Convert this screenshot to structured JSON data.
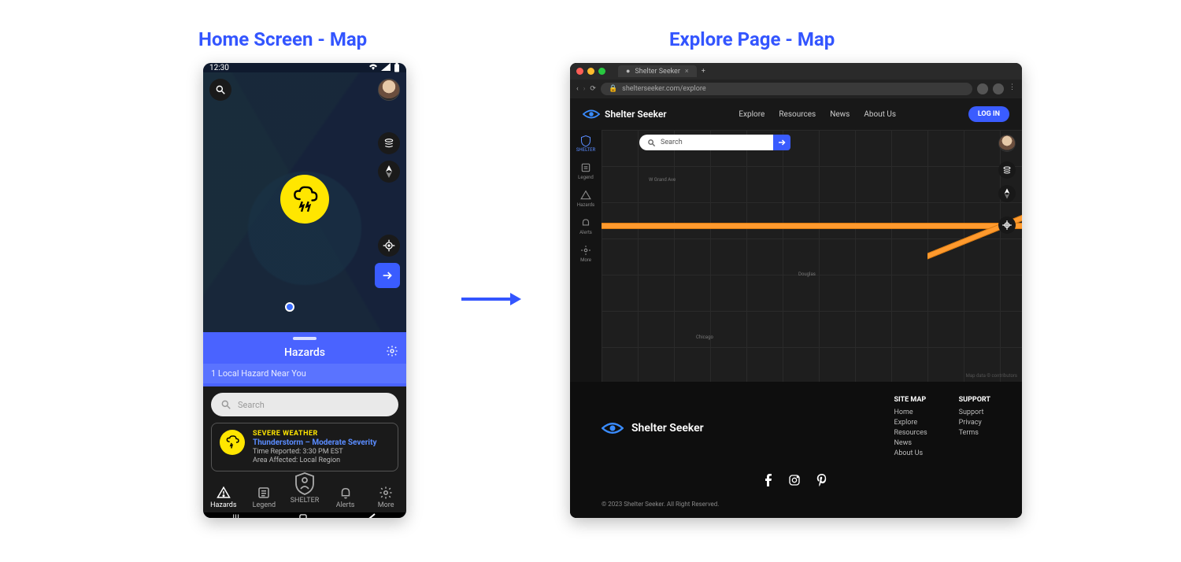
{
  "headings": {
    "left": "Home Screen - Map",
    "right": "Explore Page - Map"
  },
  "mobile": {
    "status_time": "12:30",
    "hazards_panel": {
      "title": "Hazards",
      "subhead": "1 Local Hazard Near You",
      "search_placeholder": "Search"
    },
    "severe_card": {
      "tag": "SEVERE WEATHER",
      "title": "Thunderstorm – Moderate Severity",
      "time": "Time Reported: 3:30 PM EST",
      "area": "Area Affected: Local Region"
    },
    "tabs": {
      "hazards": "Hazards",
      "legend": "Legend",
      "shelter": "SHELTER",
      "alerts": "Alerts",
      "more": "More"
    }
  },
  "desktop": {
    "browser": {
      "tab_title": "Shelter Seeker",
      "url": "shelterseeker.com/explore"
    },
    "brand": "Shelter Seeker",
    "nav": {
      "explore": "Explore",
      "resources": "Resources",
      "news": "News",
      "about": "About Us"
    },
    "login": "LOG IN",
    "sidebar": {
      "shelter": "SHELTER",
      "legend": "Legend",
      "hazards": "Hazards",
      "alerts": "Alerts",
      "more": "More"
    },
    "search_placeholder": "Search",
    "footer": {
      "sitemap_h": "SITE MAP",
      "sitemap": {
        "home": "Home",
        "explore": "Explore",
        "resources": "Resources",
        "news": "News",
        "about": "About Us"
      },
      "support_h": "SUPPORT",
      "support": {
        "support": "Support",
        "privacy": "Privacy",
        "terms": "Terms"
      },
      "copyright": "© 2023 Shelter Seeker. All Right Reserved."
    }
  }
}
